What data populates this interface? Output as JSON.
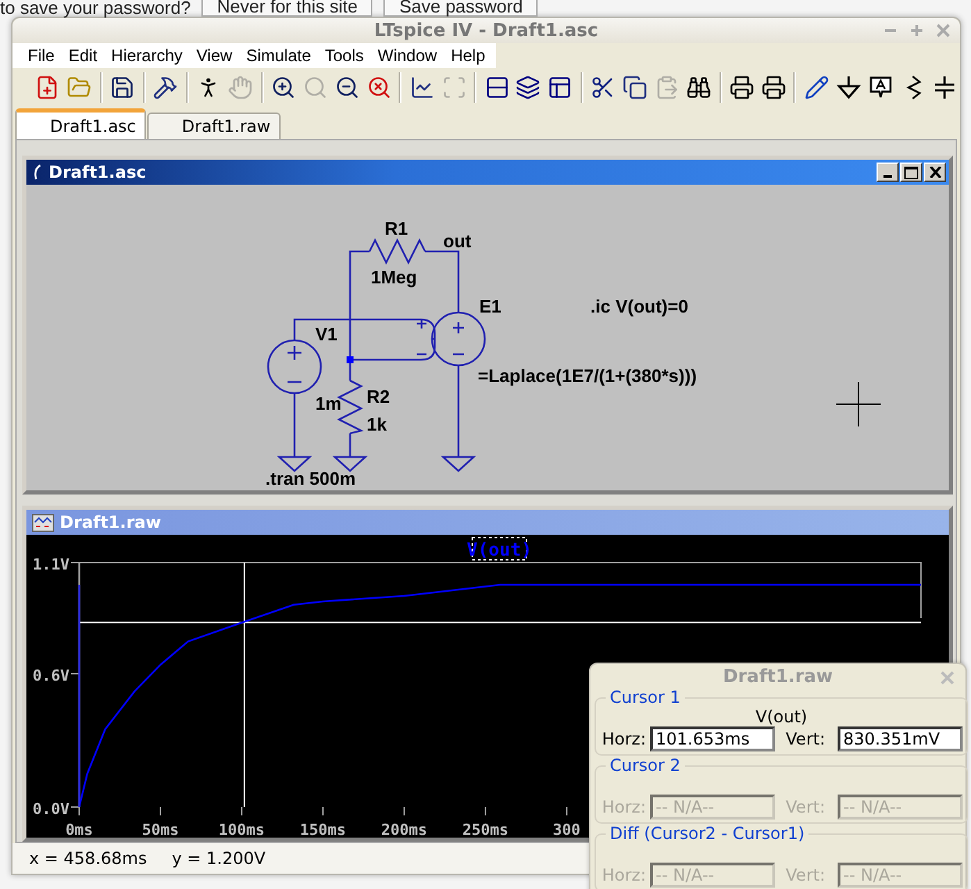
{
  "browser_bar": {
    "prompt": "to save your password?",
    "buttons": [
      "Never for this site",
      "Save password"
    ]
  },
  "window": {
    "title": "LTspice IV - Draft1.asc"
  },
  "menu": [
    "File",
    "Edit",
    "Hierarchy",
    "View",
    "Simulate",
    "Tools",
    "Window",
    "Help"
  ],
  "toolbar": [
    {
      "kind": "new",
      "disabled": false
    },
    {
      "kind": "open",
      "disabled": false
    },
    {
      "kind": "separator"
    },
    {
      "kind": "save",
      "disabled": false
    },
    {
      "kind": "separator"
    },
    {
      "kind": "control-panel",
      "disabled": false
    },
    {
      "kind": "separator"
    },
    {
      "kind": "run",
      "disabled": false
    },
    {
      "kind": "halt",
      "disabled": true
    },
    {
      "kind": "separator"
    },
    {
      "kind": "zoom-in",
      "disabled": false
    },
    {
      "kind": "pan",
      "disabled": true
    },
    {
      "kind": "zoom-out",
      "disabled": false
    },
    {
      "kind": "zoom-fit",
      "disabled": false
    },
    {
      "kind": "separator"
    },
    {
      "kind": "waveform",
      "disabled": false
    },
    {
      "kind": "autoscale",
      "disabled": true
    },
    {
      "kind": "separator"
    },
    {
      "kind": "tile",
      "disabled": false
    },
    {
      "kind": "cascade",
      "disabled": false
    },
    {
      "kind": "restore",
      "disabled": false
    },
    {
      "kind": "separator"
    },
    {
      "kind": "cut",
      "disabled": false
    },
    {
      "kind": "copy",
      "disabled": false
    },
    {
      "kind": "paste",
      "disabled": true
    },
    {
      "kind": "find",
      "disabled": false
    },
    {
      "kind": "separator"
    },
    {
      "kind": "preview",
      "disabled": false
    },
    {
      "kind": "print",
      "disabled": false
    },
    {
      "kind": "separator"
    },
    {
      "kind": "wire",
      "disabled": false
    },
    {
      "kind": "ground",
      "disabled": false
    },
    {
      "kind": "label",
      "disabled": false
    },
    {
      "kind": "resistor",
      "disabled": false
    },
    {
      "kind": "capacitor",
      "disabled": false
    }
  ],
  "tabs": [
    {
      "label": "Draft1.asc",
      "selected": true
    },
    {
      "label": "Draft1.raw",
      "selected": false
    }
  ],
  "schematic_window": {
    "title": "Draft1.asc",
    "active": true,
    "r1_name": "R1",
    "r1_value": "1Meg",
    "net_label": "out",
    "e1_name": "E1",
    "e1_value": "=Laplace(1E7/(1+(380*s)))",
    "v1_name": "V1",
    "v1_value": "1m",
    "r2_name": "R2",
    "r2_value": "1k",
    "directives": [
      ".ic V(out)=0",
      ".tran 500m"
    ]
  },
  "waveform_window": {
    "title": "Draft1.raw",
    "active": false,
    "chart_data": {
      "type": "line",
      "x": [
        0,
        5,
        16,
        34,
        50,
        67,
        100,
        132,
        150,
        200,
        259,
        300,
        350,
        400,
        450,
        518
      ],
      "series": [
        {
          "name": "V(out)",
          "color": "#0000ff",
          "values": [
            0,
            0.15,
            0.35,
            0.52,
            0.64,
            0.745,
            0.83,
            0.91,
            0.925,
            0.95,
            1.0,
            1.0,
            1.0,
            1.0,
            1.0,
            1.0
          ]
        }
      ],
      "xlim": [
        0,
        518
      ],
      "ylim": [
        0,
        1.1
      ],
      "xticks": [
        {
          "value": 0,
          "label": "0ms"
        },
        {
          "value": 50,
          "label": "50ms"
        },
        {
          "value": 100,
          "label": "100ms"
        },
        {
          "value": 150,
          "label": "150ms"
        },
        {
          "value": 200,
          "label": "200ms"
        },
        {
          "value": 250,
          "label": "250ms"
        },
        {
          "value": 300,
          "label": "300"
        }
      ],
      "yticks": [
        {
          "value": 0,
          "label": "0.0V"
        },
        {
          "value": 0.6,
          "label": "0.6V"
        },
        {
          "value": 1.1,
          "label": "1.1V"
        }
      ]
    },
    "status": [
      "x = 458.68ms",
      "y = 1.200V"
    ]
  },
  "cursor_dialog": {
    "title": "Draft1.raw",
    "groups": [
      {
        "label": "Cursor 1",
        "trace": "V(out)",
        "fields": [
          {
            "label": "Horz:",
            "value": "101.653ms",
            "disabled": false
          },
          {
            "label": "Vert:",
            "value": "830.351mV",
            "disabled": false
          }
        ]
      },
      {
        "label": "Cursor 2",
        "fields": [
          {
            "label": "Horz:",
            "value": "-- N/A--",
            "disabled": true
          },
          {
            "label": "Vert:",
            "value": "-- N/A--",
            "disabled": true
          }
        ]
      },
      {
        "label": "Diff (Cursor2 - Cursor1)",
        "fields": [
          {
            "label": "Horz:",
            "value": "-- N/A--",
            "disabled": true
          },
          {
            "label": "Vert:",
            "value": "-- N/A--",
            "disabled": true
          }
        ]
      }
    ]
  }
}
